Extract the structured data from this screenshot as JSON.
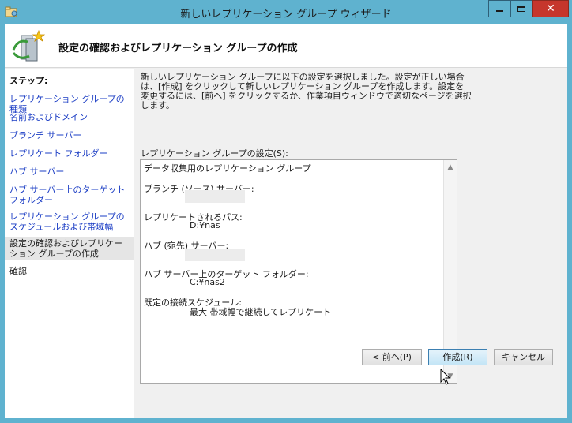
{
  "window": {
    "title": "新しいレプリケーション グループ ウィザード"
  },
  "header": {
    "title": "設定の確認およびレプリケーション グループの作成"
  },
  "steps": {
    "title": "ステップ:",
    "items": [
      "レプリケーション グループの種類",
      "名前およびドメイン",
      "ブランチ サーバー",
      "レプリケート フォルダー",
      "ハブ サーバー",
      "ハブ サーバー上のターゲット フォルダー",
      "レプリケーション グループのスケジュールおよび帯域幅",
      "設定の確認およびレプリケーション グループの作成",
      "確認"
    ],
    "current_index": 7
  },
  "main": {
    "description": "新しいレプリケーション グループに以下の設定を選択しました。設定が正しい場合は、[作成] をクリックして新しいレプリケーション グループを作成します。設定を変更するには、[前へ] をクリックするか、作業項目ウィンドウで適切なページを選択します。",
    "settings_label": "レプリケーション グループの設定(S):",
    "settings": {
      "group_type": "データ収集用のレプリケーション グループ",
      "branch_server_label": "ブランチ (ソース) サーバー:",
      "replicated_path_label": "レプリケートされるパス:",
      "replicated_path_value": "D:¥nas",
      "hub_server_label": "ハブ (宛先) サーバー:",
      "hub_target_label": "ハブ サーバー上のターゲット フォルダー:",
      "hub_target_value": "C:¥nas2",
      "schedule_label": "既定の接続スケジュール:",
      "schedule_value": "最大 帯域幅で継続してレプリケート"
    }
  },
  "buttons": {
    "back": "< 前へ(P)",
    "create": "作成(R)",
    "cancel": "キャンセル"
  }
}
